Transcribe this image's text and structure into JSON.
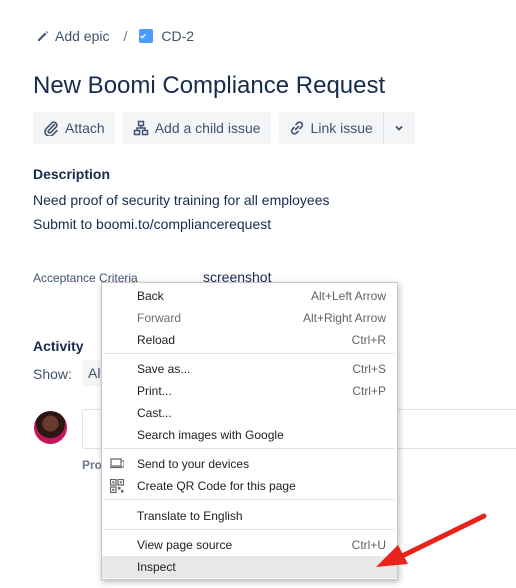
{
  "breadcrumbs": {
    "epic_label": "Add epic",
    "separator": "/",
    "issue_key": "CD-2"
  },
  "issue": {
    "title": "New Boomi Compliance Request"
  },
  "actions": {
    "attach": "Attach",
    "add_child": "Add a child issue",
    "link_issue": "Link issue"
  },
  "description": {
    "heading": "Description",
    "lines": [
      "Need proof of security training for all employees",
      "Submit to boomi.to/compliancerequest"
    ]
  },
  "acceptance_criteria": {
    "label": "Acceptance Criteria",
    "value": "screenshot"
  },
  "activity": {
    "heading": "Activity",
    "show_label": "Show:",
    "show_value": "Al",
    "pro_tip": "Pro"
  },
  "context_menu": {
    "items": [
      {
        "label": "Back",
        "shortcut": "Alt+Left Arrow"
      },
      {
        "label": "Forward",
        "shortcut": "Alt+Right Arrow"
      },
      {
        "label": "Reload",
        "shortcut": "Ctrl+R"
      },
      {
        "label": "Save as...",
        "shortcut": "Ctrl+S"
      },
      {
        "label": "Print...",
        "shortcut": "Ctrl+P"
      },
      {
        "label": "Cast...",
        "shortcut": ""
      },
      {
        "label": "Search images with Google",
        "shortcut": ""
      },
      {
        "label": "Send to your devices",
        "shortcut": "",
        "icon": "device-icon"
      },
      {
        "label": "Create QR Code for this page",
        "shortcut": "",
        "icon": "qr-code-icon"
      },
      {
        "label": "Translate to English",
        "shortcut": ""
      },
      {
        "label": "View page source",
        "shortcut": "Ctrl+U"
      },
      {
        "label": "Inspect",
        "shortcut": ""
      }
    ]
  },
  "colors": {
    "accent_checkbox": "#4c9aff",
    "annotation_arrow": "#e8231c",
    "highlight": "#e8e8e8"
  }
}
